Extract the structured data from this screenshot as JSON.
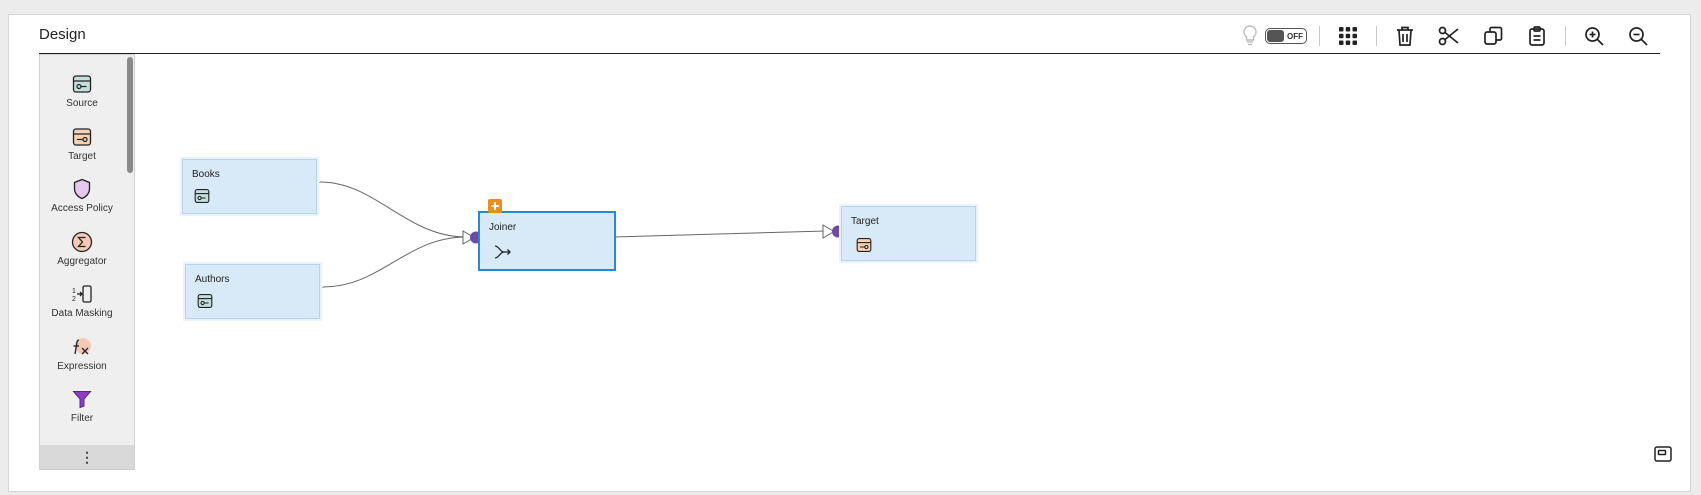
{
  "header": {
    "title": "Design"
  },
  "toolbar": {
    "toggle_label": "OFF",
    "buttons": [
      "lightbulb-icon",
      "grid-icon",
      "trash-icon",
      "scissors-icon",
      "copy-icon",
      "paste-icon",
      "zoom-in-icon",
      "zoom-out-icon"
    ]
  },
  "palette": {
    "items": [
      {
        "label": "Source",
        "icon": "source-icon"
      },
      {
        "label": "Target",
        "icon": "target-icon"
      },
      {
        "label": "Access Policy",
        "icon": "shield-icon"
      },
      {
        "label": "Aggregator",
        "icon": "sigma-icon"
      },
      {
        "label": "Data Masking",
        "icon": "data-masking-icon"
      },
      {
        "label": "Expression",
        "icon": "expression-icon"
      },
      {
        "label": "Filter",
        "icon": "filter-icon"
      }
    ],
    "more": "⋮"
  },
  "canvas": {
    "nodes": {
      "books": {
        "label": "Books"
      },
      "authors": {
        "label": "Authors"
      },
      "joiner": {
        "label": "Joiner"
      },
      "target": {
        "label": "Target"
      }
    }
  },
  "colors": {
    "accent": "#2a86d6",
    "port": "#6f4aa3",
    "node_fill": "#d8eaf8",
    "badge": "#f08c1a"
  }
}
